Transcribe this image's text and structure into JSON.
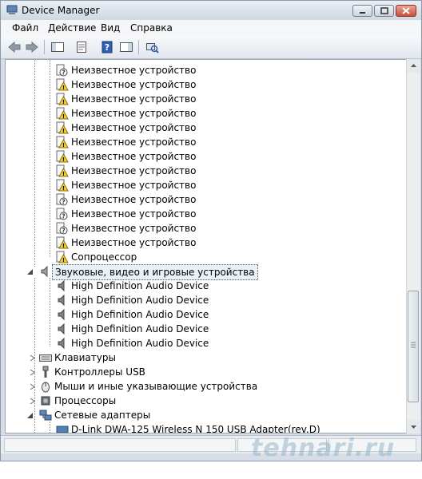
{
  "window": {
    "title": "Device Manager",
    "accent": "#cfd8e2"
  },
  "menu": {
    "items": [
      "Файл",
      "Действие",
      "Вид",
      "Справка"
    ]
  },
  "toolbar": {
    "buttons": [
      "back-arrow-icon",
      "forward-arrow-icon",
      "console-tree-icon",
      "properties-icon",
      "help-icon",
      "action-pane-icon",
      "scan-hardware-icon"
    ]
  },
  "tree": {
    "unknown_label": "Неизвестное устройство",
    "coprocessor": "Сопроцессор",
    "sound_category": "Звуковые, видео и игровые устройства",
    "audio_device": "High Definition Audio Device",
    "keyboards": "Клавиатуры",
    "usb_controllers": "Контроллеры USB",
    "mice": "Мыши и иные указывающие устройства",
    "processors": "Процессоры",
    "network_adapters": "Сетевые адаптеры",
    "network_device": "D-Link DWA-125 Wireless N 150 USB Adapter(rev.D)"
  },
  "watermark": "tehnari.ru"
}
